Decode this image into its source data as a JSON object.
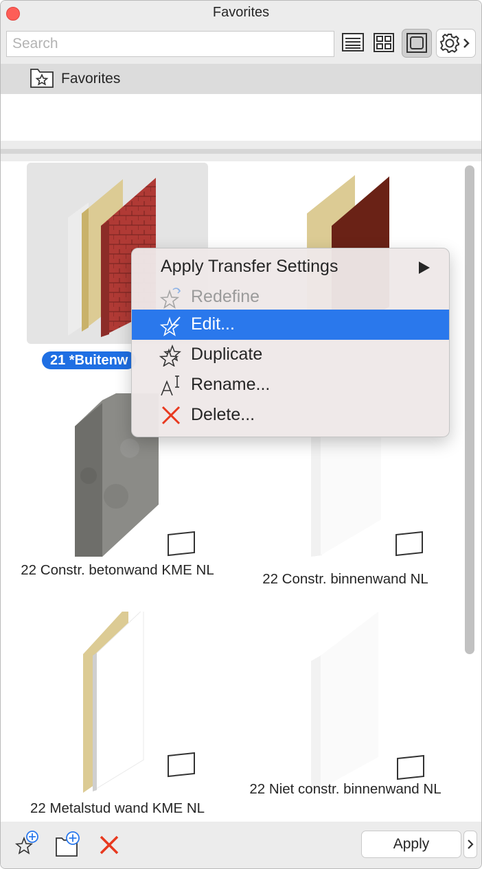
{
  "window": {
    "title": "Favorites"
  },
  "search": {
    "placeholder": "Search",
    "value": ""
  },
  "toolbar": {
    "view_modes": [
      "list-view-icon",
      "grid-view-icon",
      "large-view-icon"
    ],
    "active_view": "large-view-icon",
    "settings_icon": "gear-icon"
  },
  "folder": {
    "label": "Favorites",
    "icon": "star-folder-icon"
  },
  "favorites": [
    {
      "label": "21 *Buitenw",
      "selected": true
    },
    {
      "label": ""
    },
    {
      "label": "22 Constr. betonwand KME NL"
    },
    {
      "label": "22 Constr. binnenwand NL"
    },
    {
      "label": "22 Metalstud wand KME NL"
    },
    {
      "label": "22 Niet constr. binnenwand NL"
    }
  ],
  "context_menu": {
    "items": [
      {
        "label": "Apply Transfer Settings",
        "submenu": true
      },
      {
        "label": "Redefine",
        "icon": "redefine-star-icon",
        "disabled": true
      },
      {
        "label": "Edit...",
        "icon": "edit-star-icon",
        "highlighted": true
      },
      {
        "label": "Duplicate",
        "icon": "duplicate-star-icon"
      },
      {
        "label": "Rename...",
        "icon": "rename-icon"
      },
      {
        "label": "Delete...",
        "icon": "delete-x-icon"
      }
    ]
  },
  "bottom": {
    "apply_label": "Apply"
  },
  "colors": {
    "selection_blue": "#1f6fe3",
    "menu_highlight": "#2a78ec",
    "delete_red": "#e8391f"
  }
}
